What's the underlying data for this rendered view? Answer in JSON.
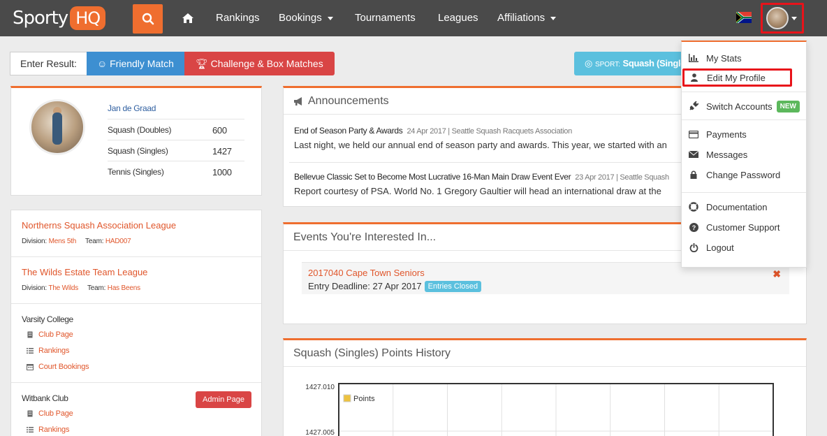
{
  "navbar": {
    "brand_left": "Sporty",
    "brand_right": "HQ",
    "items": [
      {
        "label": "Rankings"
      },
      {
        "label": "Bookings"
      },
      {
        "label": "Tournaments"
      },
      {
        "label": "Leagues"
      },
      {
        "label": "Affiliations"
      }
    ]
  },
  "result_bar": {
    "label": "Enter Result:",
    "friendly": "Friendly Match",
    "challenge": "Challenge & Box Matches"
  },
  "sport": {
    "label": "SPORT:",
    "value": "Squash (Singles)"
  },
  "profile": {
    "name": "Jan de Graad",
    "ratings": [
      {
        "name": "Squash (Doubles)",
        "value": "600"
      },
      {
        "name": "Squash (Singles)",
        "value": "1427"
      },
      {
        "name": "Tennis (Singles)",
        "value": "1000"
      }
    ]
  },
  "leagues": [
    {
      "title": "Northerns Squash Association League",
      "division_label": "Division:",
      "division": "Mens 5th",
      "team_label": "Team:",
      "team": "HAD007"
    },
    {
      "title": "The Wilds Estate Team League",
      "division_label": "Division:",
      "division": "The Wilds",
      "team_label": "Team:",
      "team": "Has Beens"
    }
  ],
  "clubs": [
    {
      "name": "Varsity College",
      "links": [
        "Club Page",
        "Rankings",
        "Court Bookings"
      ]
    },
    {
      "name": "Witbank Club",
      "links": [
        "Club Page",
        "Rankings"
      ],
      "admin": "Admin Page"
    }
  ],
  "announcements": {
    "heading": "Announcements",
    "items": [
      {
        "title": "End of Season Party & Awards",
        "date": "24 Apr 2017 | Seattle Squash Racquets Association",
        "body": "Last night, we held our annual end of season party and awards. This year, we started with an"
      },
      {
        "title": "Bellevue Classic Set to Become Most Lucrative 16-Man Main Draw Event Ever",
        "date": "23 Apr 2017 | Seattle Squash",
        "body": "Report courtesy of PSA. World No. 1 Gregory Gaultier will head an international draw at the"
      }
    ]
  },
  "events": {
    "heading": "Events You're Interested In...",
    "items": [
      {
        "title": "2017040 Cape Town Seniors",
        "deadline": "Entry Deadline: 27 Apr 2017",
        "badge": "Entries Closed"
      }
    ]
  },
  "history": {
    "heading": "Squash (Singles) Points History"
  },
  "chart_data": {
    "type": "line",
    "title": "Squash (Singles) Points History",
    "series": [
      {
        "name": "Points",
        "values": []
      }
    ],
    "yticks": [
      "1427.010",
      "1427.005"
    ],
    "ylim": [
      1427.0,
      1427.01
    ],
    "legend": "top-left",
    "grid": true,
    "series_color": "#edc240"
  },
  "dropdown": {
    "items": [
      {
        "label": "My Stats",
        "icon": "bar-chart-icon"
      },
      {
        "label": "Edit My Profile",
        "icon": "user-icon"
      },
      {
        "label": "Switch Accounts",
        "icon": "plug-icon",
        "badge": "NEW"
      },
      {
        "label": "Payments",
        "icon": "credit-card-icon"
      },
      {
        "label": "Messages",
        "icon": "envelope-icon"
      },
      {
        "label": "Change Password",
        "icon": "lock-icon"
      },
      {
        "label": "Documentation",
        "icon": "life-ring-icon"
      },
      {
        "label": "Customer Support",
        "icon": "question-icon"
      },
      {
        "label": "Logout",
        "icon": "power-icon"
      }
    ]
  },
  "colors": {
    "accent": "#ef6e2f",
    "navbar": "#4a4a4a",
    "link": "#e0562b",
    "highlight": "#e8131a"
  }
}
